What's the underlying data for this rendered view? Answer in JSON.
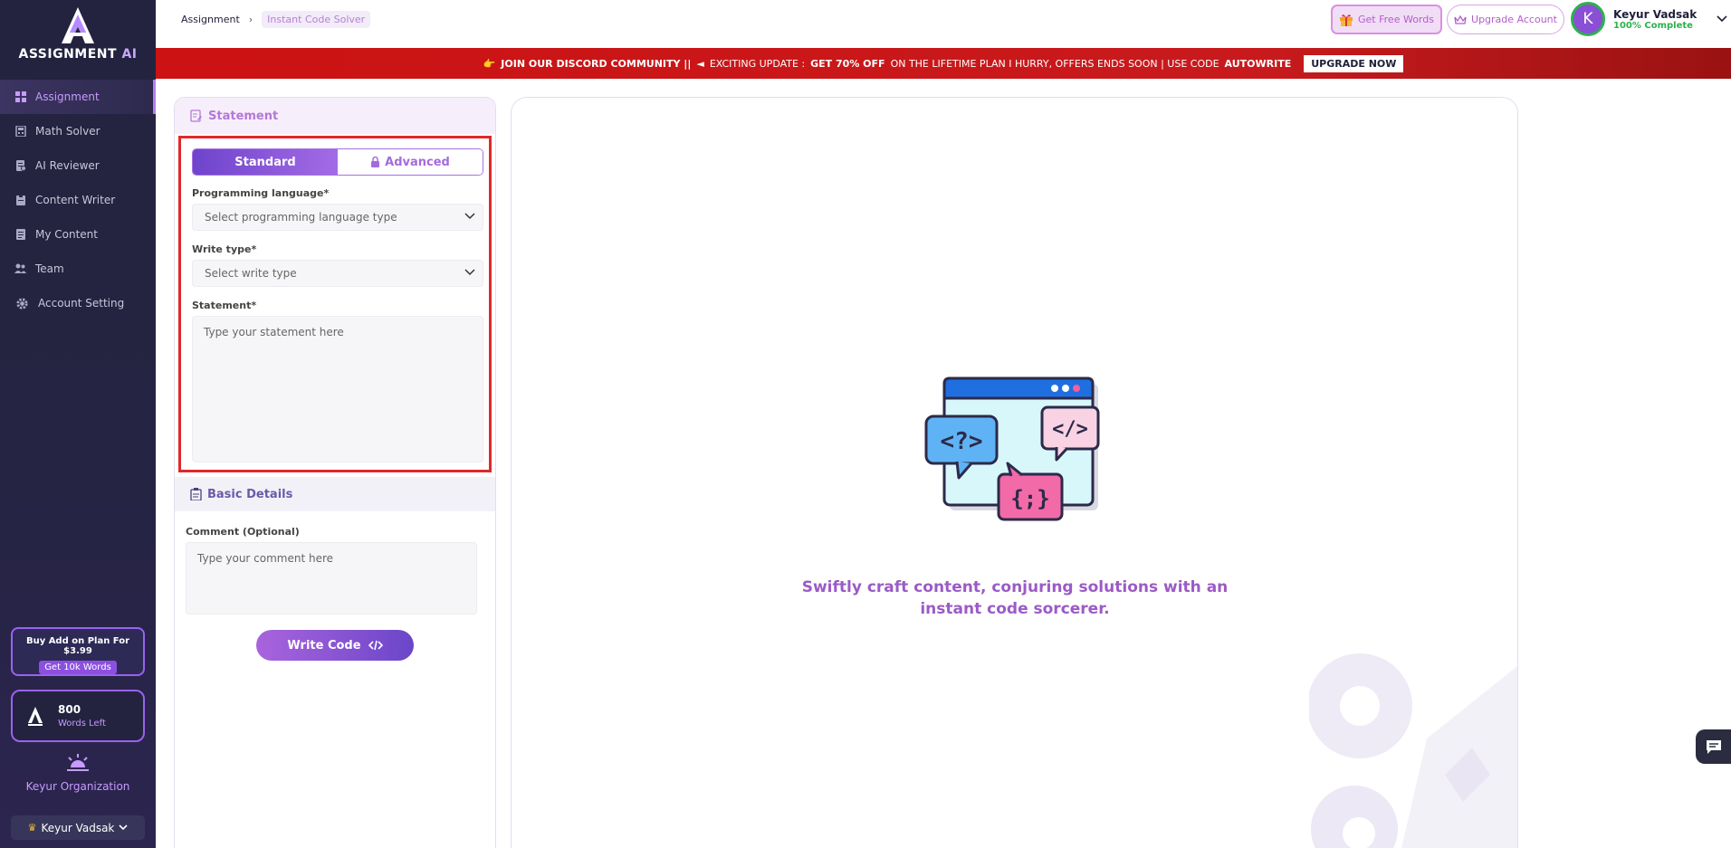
{
  "brand": {
    "name_main": "ASSIGNMENT",
    "name_ai": "AI"
  },
  "sidebar": {
    "items": [
      {
        "label": "Assignment",
        "icon": "grid-icon",
        "active": true
      },
      {
        "label": "Math Solver",
        "icon": "calculator-icon",
        "active": false
      },
      {
        "label": "AI Reviewer",
        "icon": "document-check-icon",
        "active": false
      },
      {
        "label": "Content Writer",
        "icon": "clipboard-icon",
        "active": false
      },
      {
        "label": "My Content",
        "icon": "document-icon",
        "active": false
      },
      {
        "label": "Team",
        "icon": "team-icon",
        "active": false
      },
      {
        "label": "Account Setting",
        "icon": "gear-icon",
        "active": false
      }
    ],
    "promo": {
      "title": "Buy Add on Plan For $3.99",
      "button": "Get 10k Words"
    },
    "words": {
      "count": "800",
      "label": "Words Left"
    },
    "organization": "Keyur Organization",
    "user_select": "Keyur Vadsak"
  },
  "header": {
    "breadcrumb": {
      "root": "Assignment",
      "current": "Instant Code Solver"
    },
    "free_words_label": "Get Free Words",
    "upgrade_label": "Upgrade Account",
    "profile": {
      "initial": "K",
      "name": "Keyur Vadsak",
      "status": "100% Complete"
    }
  },
  "banner": {
    "part1": "JOIN OUR DISCORD COMMUNITY ||",
    "part2": "EXCITING UPDATE :",
    "part3": "GET 70% OFF",
    "part4": "ON THE LIFETIME PLAN I HURRY, OFFERS ENDS SOON | USE CODE",
    "code": "AUTOWRITE",
    "button": "UPGRADE NOW"
  },
  "form": {
    "section_title": "Statement",
    "tabs": {
      "standard": "Standard",
      "advanced": "Advanced"
    },
    "language_label": "Programming language*",
    "language_placeholder": "Select programming language type",
    "write_type_label": "Write type*",
    "write_type_placeholder": "Select write type",
    "statement_label": "Statement*",
    "statement_placeholder": "Type your statement here",
    "basic_title": "Basic Details",
    "comment_label": "Comment (Optional)",
    "comment_placeholder": "Type your comment here",
    "submit_label": "Write Code"
  },
  "preview": {
    "caption_line1": "Swiftly craft content, conjuring solutions with an",
    "caption_line2": "instant code sorcerer.",
    "bubble_left": "<?>",
    "bubble_right": "</>",
    "bubble_bottom": "{;}"
  },
  "colors": {
    "accent": "#a46bdf",
    "sidebar_bg": "#23233f",
    "banner": "#cc1212",
    "success": "#2bb24c"
  }
}
